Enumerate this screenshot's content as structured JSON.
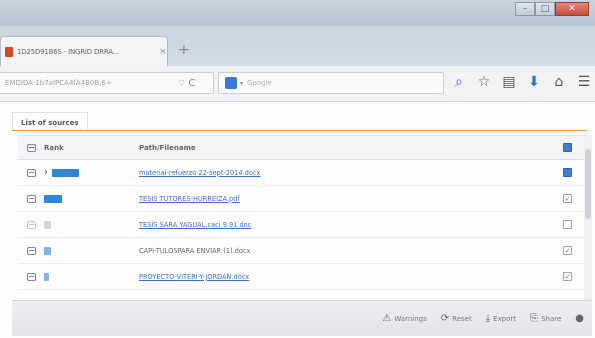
{
  "window": {
    "minimize_glyph": "–",
    "maximize_glyph": "□",
    "close_glyph": "✕"
  },
  "tab": {
    "title": "1D25D91B6S - INGRID DRRA...",
    "close_glyph": "×",
    "new_tab_glyph": "+"
  },
  "navbar": {
    "url": "EMDIDA-1b7aIPCA4fA4B0B,6+",
    "url_dropdown_glyph": "▽",
    "reload_glyph": "C",
    "search_placeholder": "Google",
    "search_dropdown_glyph": "▾",
    "icons": [
      {
        "name": "search-icon",
        "glyph": "⌕"
      },
      {
        "name": "star-icon",
        "glyph": "☆"
      },
      {
        "name": "clipboard-icon",
        "glyph": "▤"
      },
      {
        "name": "download-icon",
        "glyph": "⬇"
      },
      {
        "name": "home-icon",
        "glyph": "⌂"
      },
      {
        "name": "menu-icon",
        "glyph": "☰"
      }
    ]
  },
  "section": {
    "tab_label": "List of sources"
  },
  "table": {
    "headers": {
      "rank": "Rank",
      "path": "Path/Filename"
    },
    "rows": [
      {
        "path": "material-refuerzo 22-sept-2014.docx",
        "rank_fraction": 0.45,
        "link": true,
        "expanded": true,
        "checked": "blue"
      },
      {
        "path": "TESIS TUTORES-HURREIZA.pdf",
        "rank_fraction": 0.3,
        "link": true,
        "expanded": false,
        "checked": "tick"
      },
      {
        "path": "TESIS SARA YAGUAL.caci 9 91 doc",
        "rank_fraction": 0.12,
        "link": true,
        "expanded": false,
        "checked": "empty"
      },
      {
        "path": "CAPÍ-TULOSPARA ENVIAR (1).docx",
        "rank_fraction": 0.12,
        "link": false,
        "expanded": false,
        "checked": "tick"
      },
      {
        "path": "PROYECTO-VITERI-Y-JORDÁN.docx",
        "rank_fraction": 0.08,
        "link": true,
        "expanded": false,
        "checked": "tick"
      }
    ]
  },
  "footer": {
    "warnings_label": "Warnings",
    "reset_label": "Reset",
    "export_label": "Export",
    "share_label": "Share",
    "help_glyph": "●"
  },
  "colors": {
    "accent_orange": "#e49a3c",
    "rank_blue": "#2f86d6",
    "link_blue": "#3d6fc4",
    "close_red": "#c84a3b"
  }
}
